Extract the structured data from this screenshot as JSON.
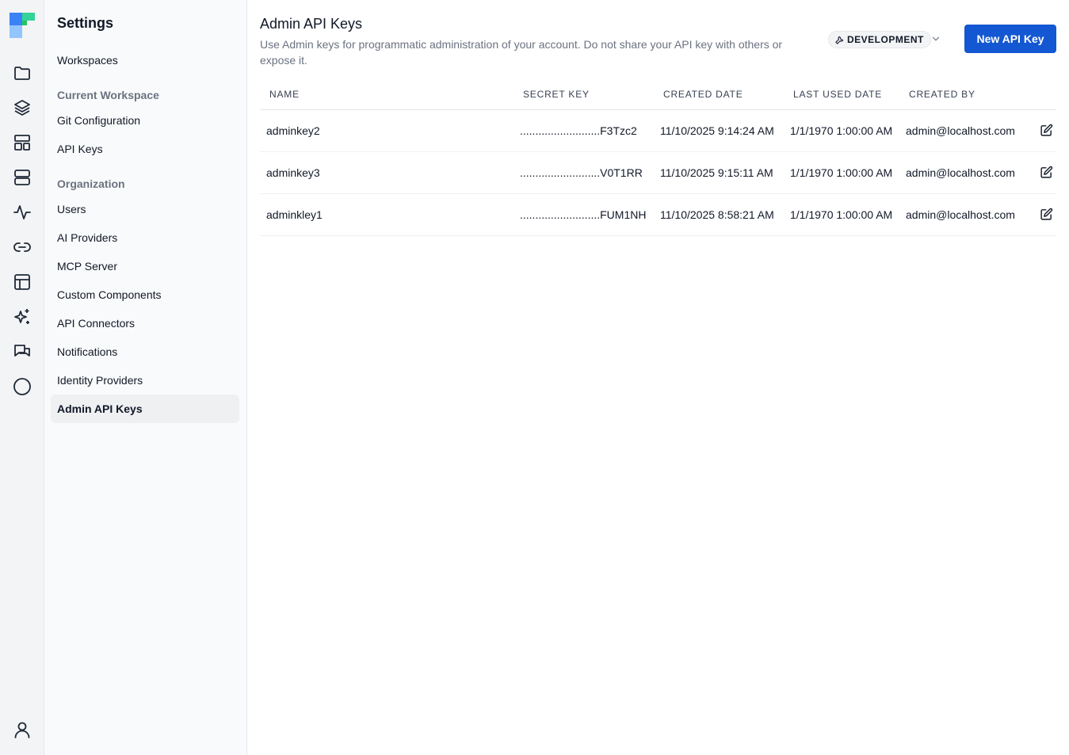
{
  "rail": {
    "icons": [
      "folder-icon",
      "layers-icon",
      "layout-icon",
      "server-icon",
      "activity-icon",
      "link-icon",
      "table-icon",
      "sparkles-icon",
      "chat-icon",
      "circle-icon",
      "user-icon"
    ]
  },
  "sidebar": {
    "title": "Settings",
    "workspaces": "Workspaces",
    "current_workspace_heading": "Current Workspace",
    "git_configuration": "Git Configuration",
    "api_keys": "API Keys",
    "organization_heading": "Organization",
    "users": "Users",
    "ai_providers": "AI Providers",
    "mcp_server": "MCP Server",
    "custom_components": "Custom Components",
    "api_connectors": "API Connectors",
    "notifications": "Notifications",
    "identity_providers": "Identity Providers",
    "admin_api_keys": "Admin API Keys"
  },
  "main": {
    "title": "Admin API Keys",
    "description": "Use Admin keys for programmatic administration of your account. Do not share your API key with others or expose it.",
    "environment": "DEVELOPMENT",
    "new_button": "New API Key",
    "columns": {
      "name": "NAME",
      "secret": "SECRET KEY",
      "created": "CREATED DATE",
      "last_used": "LAST USED DATE",
      "created_by": "CREATED BY"
    },
    "rows": [
      {
        "name": "adminkey2",
        "secret": "..........................F3Tzc2",
        "created": "11/10/2025 9:14:24 AM",
        "last_used": "1/1/1970 1:00:00 AM",
        "created_by": "admin@localhost.com"
      },
      {
        "name": "adminkey3",
        "secret": "..........................V0T1RR",
        "created": "11/10/2025 9:15:11 AM",
        "last_used": "1/1/1970 1:00:00 AM",
        "created_by": "admin@localhost.com"
      },
      {
        "name": "adminkley1",
        "secret": "..........................FUM1NH",
        "created": "11/10/2025 8:58:21 AM",
        "last_used": "1/1/1970 1:00:00 AM",
        "created_by": "admin@localhost.com"
      }
    ]
  },
  "colors": {
    "accent": "#1457d2",
    "sidebar_bg": "#f9fafb",
    "rail_bg": "#f3f4f6"
  }
}
